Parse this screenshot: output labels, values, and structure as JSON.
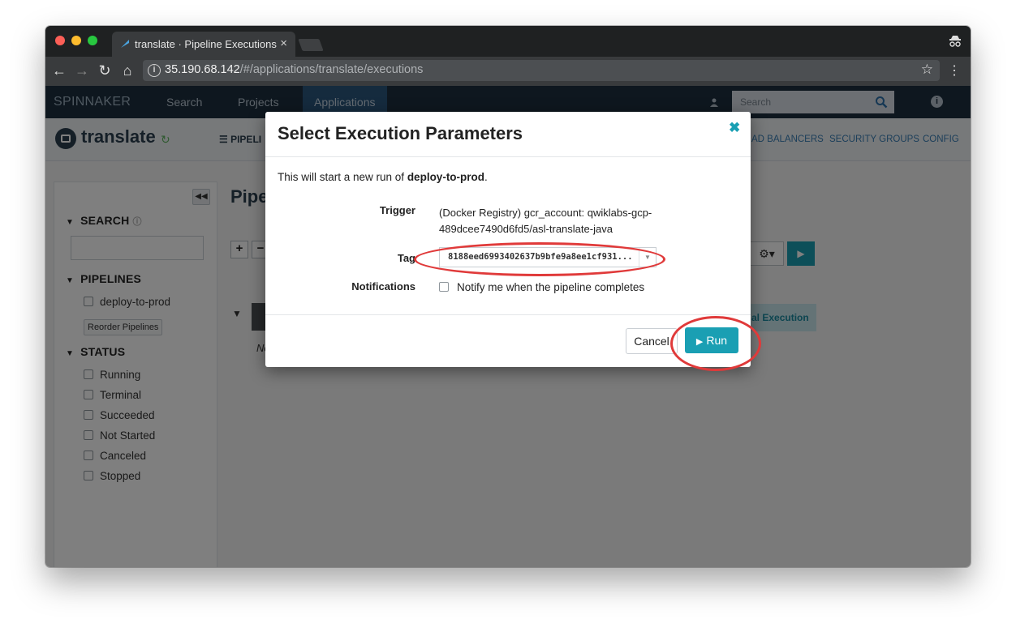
{
  "browser": {
    "tab_title": "translate · Pipeline Executions",
    "url_host": "35.190.68.142",
    "url_path": "/#/applications/translate/executions"
  },
  "topnav": {
    "brand": "SPINNAKER",
    "links": [
      "Search",
      "Projects",
      "Applications"
    ],
    "search_placeholder": "Search"
  },
  "app": {
    "name": "translate",
    "subnav_pipelines": "PIPELI",
    "subnav_links": [
      "AD BALANCERS",
      "SECURITY GROUPS",
      "CONFIG"
    ]
  },
  "sidebar": {
    "search_heading": "SEARCH",
    "pipelines_heading": "PIPELINES",
    "pipelines": [
      "deploy-to-prod"
    ],
    "reorder_label": "Reorder Pipelines",
    "status_heading": "STATUS",
    "statuses": [
      "Running",
      "Terminal",
      "Succeeded",
      "Not Started",
      "Canceled",
      "Stopped"
    ]
  },
  "main": {
    "title": "Pipe",
    "no_text": "No",
    "manual_execution_label": "al Execution"
  },
  "modal": {
    "title": "Select Execution Parameters",
    "intro_prefix": "This will start a new run of ",
    "pipeline_name": "deploy-to-prod",
    "intro_suffix": ".",
    "trigger_label": "Trigger",
    "trigger_value": "(Docker Registry) gcr_account: qwiklabs-gcp-489dcee7490d6fd5/asl-translate-java",
    "tag_label": "Tag",
    "tag_value": "8188eed6993402637b9bfe9a8ee1cf931...",
    "notifications_label": "Notifications",
    "notify_text": "Notify me when the pipeline completes",
    "cancel_label": "Cancel",
    "run_label": "Run"
  },
  "colors": {
    "accent": "#1a9fb3",
    "nav_bg": "#1d2f3f",
    "annotation": "#e03a3a"
  }
}
